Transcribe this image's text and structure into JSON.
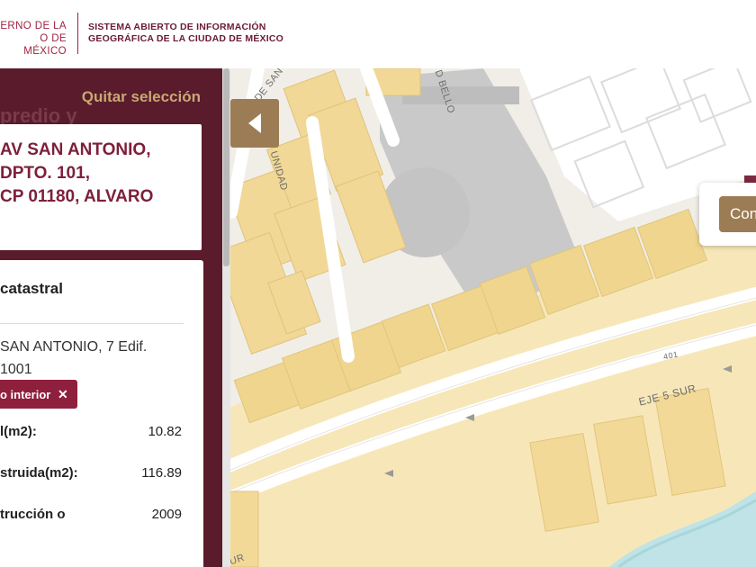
{
  "header": {
    "gov_line1": "ERNO DE LA",
    "gov_line2": "O DE MÉXICO",
    "system_line1": "SISTEMA ABIERTO DE INFORMACIÓN",
    "system_line2": "GEOGRÁFICA DE LA CIUDAD DE MÉXICO"
  },
  "sidebar": {
    "quitar_label": "Quitar selección",
    "ghost_title": "predio y",
    "address": "AV SAN ANTONIO,\n DPTO. 101,\nCP 01180, ALVARO",
    "info_heading": "catastral",
    "info_address": " SAN ANTONIO, 7 Edif.\n1001",
    "chip_label": "o interior",
    "chip_close": "✕",
    "rows": [
      {
        "label": "l(m2):",
        "value": "10.82"
      },
      {
        "label": "struida(m2):",
        "value": "116.89"
      },
      {
        "label": "trucción o",
        "value": "2009"
      }
    ]
  },
  "map": {
    "collapse_icon": "chevron-left-icon",
    "popup_button": "Con",
    "streets": {
      "eje5": "EJE 5 SUR",
      "road401": "401",
      "unidad": "UNIDAD",
      "desan": "DE SAN",
      "bello": "D BELLO",
      "sur": "UR"
    }
  },
  "colors": {
    "brand": "#9f2241",
    "sidebar_bg": "#5a1b2c",
    "accent_gold": "#9c7c54",
    "building": "#f3dfa2",
    "lot": "#f7e9bd"
  }
}
